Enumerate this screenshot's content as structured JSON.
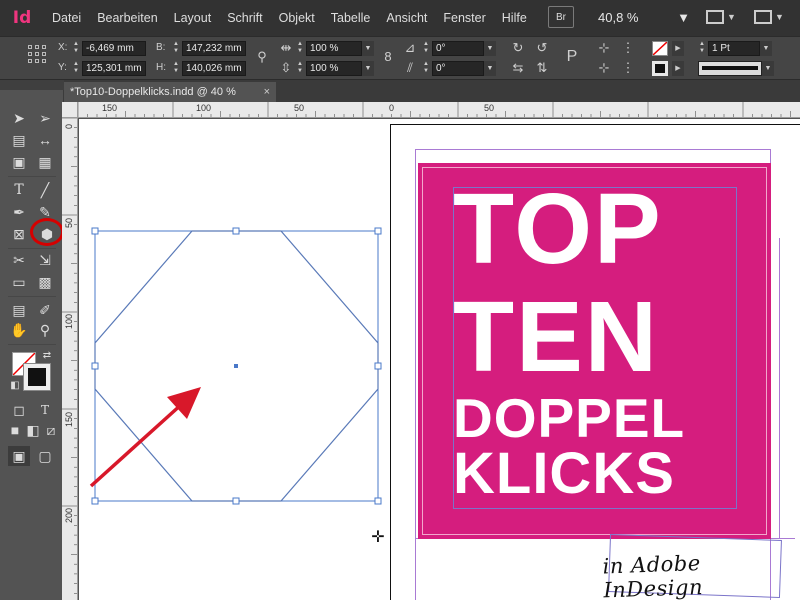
{
  "app": {
    "logo": "Id",
    "menu": [
      "Datei",
      "Bearbeiten",
      "Layout",
      "Schrift",
      "Objekt",
      "Tabelle",
      "Ansicht",
      "Fenster",
      "Hilfe"
    ],
    "bridge_button": "Br",
    "zoom": "40,8 %"
  },
  "control": {
    "x_label": "X:",
    "x_value": "-6,469 mm",
    "y_label": "Y:",
    "y_value": "125,301 mm",
    "w_label": "B:",
    "w_value": "147,232 mm",
    "h_label": "H:",
    "h_value": "140,026 mm",
    "scale_x": "100 %",
    "scale_y": "100 %",
    "rotation": "0°",
    "shear": "0°",
    "stroke_weight": "1 Pt"
  },
  "document": {
    "tab_title": "*Top10-Doppelklicks.indd @ 40 %",
    "close_glyph": "×"
  },
  "rulers": {
    "top": [
      "150",
      "100",
      "50",
      "0",
      "50"
    ],
    "left": [
      "0",
      "50",
      "100",
      "150",
      "200"
    ]
  },
  "artwork": {
    "line1": "TOP",
    "line2": "TEN",
    "line3": "DOPPEL",
    "line4": "KLICKS",
    "subline": "in Adobe InDesign",
    "pink": "#d51d7e"
  },
  "colors": {
    "annotation_red": "#d50000",
    "selection_blue": "#4a78c8"
  }
}
